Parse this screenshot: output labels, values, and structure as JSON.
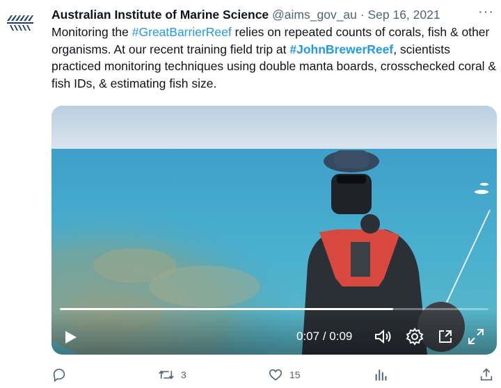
{
  "tweet": {
    "author_name": "Australian Institute of Marine Science",
    "handle": "@aims_gov_au",
    "separator": "·",
    "date": "Sep 16, 2021",
    "more_label": "···",
    "text_parts": {
      "p1": "Monitoring the ",
      "tag1": "#GreatBarrierReef",
      "p2": " relies on repeated counts of corals, fish & other organisms. At our recent training field trip at ",
      "tag2": "#JohnBrewerReef",
      "p3": ", scientists practiced monitoring techniques using double manta boards, crosschecked coral & fish IDs, & estimating fish size."
    },
    "link_color": "#1d9bf0"
  },
  "video": {
    "current_time": "0:07",
    "duration": "0:09",
    "time_separator": " / ",
    "progress_fraction": 0.778
  },
  "actions": {
    "reply_count": "",
    "retweet_count": "3",
    "like_count": "15"
  }
}
